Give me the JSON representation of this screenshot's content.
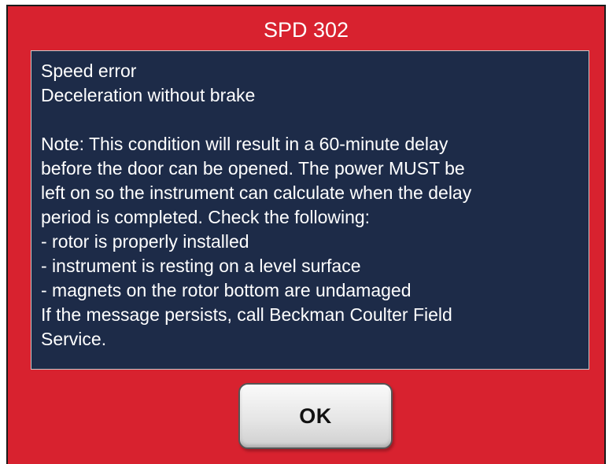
{
  "dialog": {
    "title": "SPD 302",
    "message_lines": [
      "Speed error",
      "Deceleration without brake",
      "",
      "Note: This condition will result in a 60-minute delay",
      "before the door can be opened. The power MUST be",
      "left on so the instrument can calculate when the delay",
      "period is completed. Check the following:",
      "- rotor is properly installed",
      "- instrument is resting on a level surface",
      "- magnets on the rotor bottom are undamaged",
      "If the message persists, call Beckman Coulter Field",
      "Service."
    ],
    "ok_label": "OK"
  },
  "colors": {
    "dialog_background": "#d8222f",
    "message_background": "#1d2b48",
    "text": "#ffffff",
    "button_face": "#e6e6e6"
  }
}
